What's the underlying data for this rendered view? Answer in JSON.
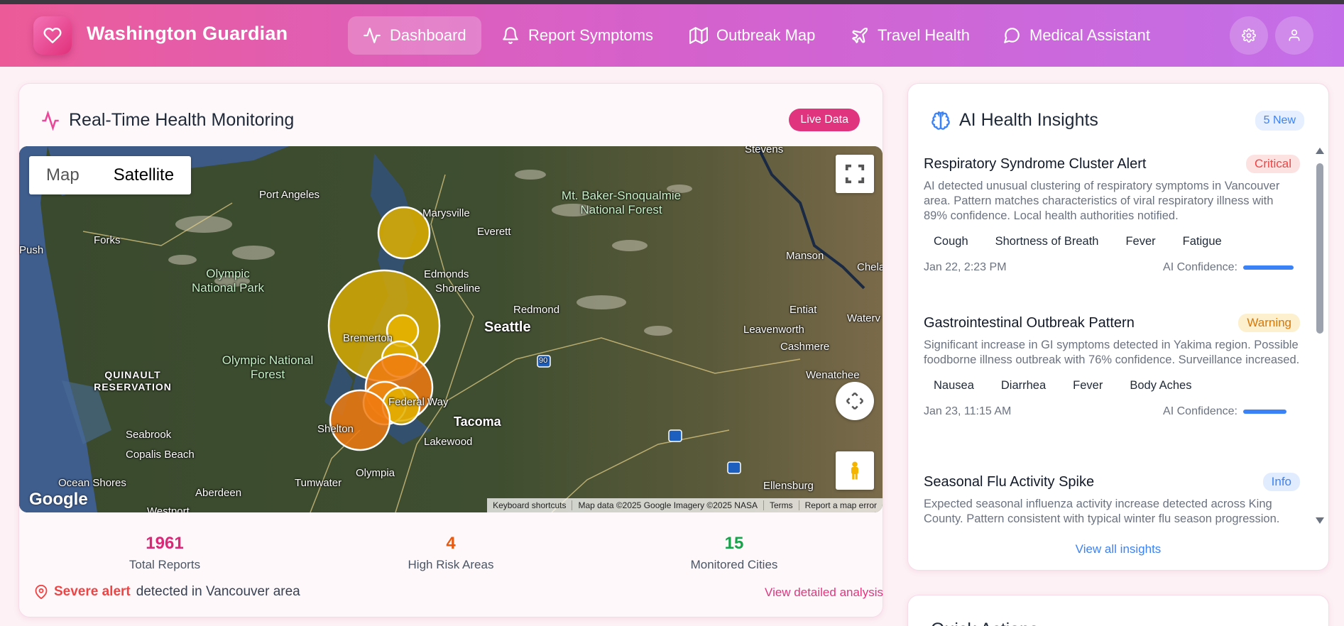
{
  "app": {
    "brand": "Washington Guardian"
  },
  "nav": {
    "items": [
      {
        "label": "Dashboard",
        "icon": "activity-icon",
        "active": true
      },
      {
        "label": "Report Symptoms",
        "icon": "bell-icon",
        "active": false
      },
      {
        "label": "Outbreak Map",
        "icon": "map-icon",
        "active": false
      },
      {
        "label": "Travel Health",
        "icon": "plane-icon",
        "active": false
      },
      {
        "label": "Medical Assistant",
        "icon": "message-circle-icon",
        "active": false
      }
    ]
  },
  "monitor": {
    "title": "Real-Time Health Monitoring",
    "live_badge": "Live Data",
    "map": {
      "toggle_map": "Map",
      "toggle_satellite": "Satellite",
      "selected": "Satellite",
      "google": "Google",
      "attribution": [
        "Keyboard shortcuts",
        "Map data ©2025 Google Imagery ©2025 NASA",
        "Terms",
        "Report a map error"
      ],
      "places": [
        "Stevens",
        "Port Angeles",
        "Marysville",
        "Everett",
        "Mt. Baker-Snoqualmie National Forest",
        "Forks",
        "Push",
        "Edmonds",
        "Shoreline",
        "Manson",
        "Chela",
        "Olympic National Park",
        "Redmond",
        "Seattle",
        "Entiat",
        "Waterv",
        "Bremerton",
        "Leavenworth",
        "Cashmere",
        "Olympic National Forest",
        "QUINAULT RESERVATION",
        "Wenatchee",
        "Federal Way",
        "Tacoma",
        "Seabrook",
        "Shelton",
        "Copalis Beach",
        "Lakewood",
        "Ocean Shores",
        "Olympia",
        "Aberdeen",
        "Tumwater",
        "Ellensburg",
        "Westport",
        "90"
      ]
    },
    "stats": [
      {
        "value": "1961",
        "label": "Total Reports",
        "color": "#db2777"
      },
      {
        "value": "4",
        "label": "High Risk Areas",
        "color": "#ea580c"
      },
      {
        "value": "15",
        "label": "Monitored Cities",
        "color": "#16a34a"
      }
    ],
    "alert": {
      "strong": "Severe alert",
      "text": "detected in Vancouver area"
    },
    "detail_link": "View detailed analysis"
  },
  "insights": {
    "title": "AI Health Insights",
    "new_badge": "5 New",
    "items": [
      {
        "title": "Respiratory Syndrome Cluster Alert",
        "severity": "Critical",
        "severity_class": "critical",
        "description": "AI detected unusual clustering of respiratory symptoms in Vancouver area. Pattern matches characteristics of viral respiratory illness with 89% confidence. Local health authorities notified.",
        "tags": [
          "Cough",
          "Shortness of Breath",
          "Fever",
          "Fatigue"
        ],
        "time": "Jan 22, 2:23 PM",
        "confidence_label": "AI Confidence:",
        "confidence": 0.89
      },
      {
        "title": "Gastrointestinal Outbreak Pattern",
        "severity": "Warning",
        "severity_class": "warning",
        "description": "Significant increase in GI symptoms detected in Yakima region. Possible foodborne illness outbreak with 76% confidence. Surveillance increased.",
        "tags": [
          "Nausea",
          "Diarrhea",
          "Fever",
          "Body Aches"
        ],
        "time": "Jan 23, 11:15 AM",
        "confidence_label": "AI Confidence:",
        "confidence": 0.76
      },
      {
        "title": "Seasonal Flu Activity Spike",
        "severity": "Info",
        "severity_class": "info",
        "description": "Expected seasonal influenza activity increase detected across King County. Pattern consistent with typical winter flu season progression.",
        "tags": [],
        "time": "",
        "confidence_label": "",
        "confidence": null
      }
    ],
    "view_all": "View all insights"
  },
  "quick_actions": {
    "title": "Quick Actions"
  }
}
